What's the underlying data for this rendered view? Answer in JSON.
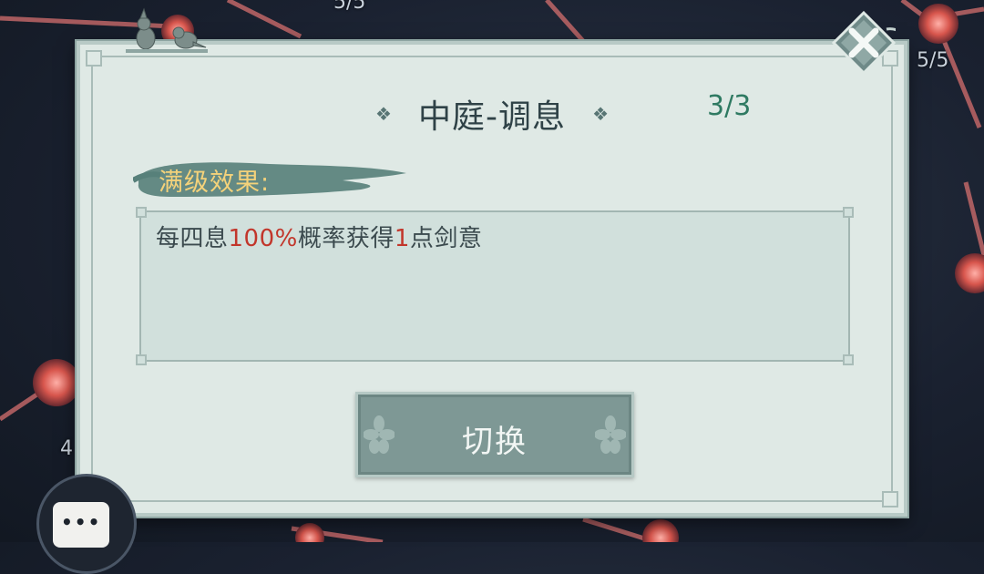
{
  "background": {
    "top_count": "5/5",
    "right_count": "5/5",
    "left_count": "4"
  },
  "dialog": {
    "title": "中庭-调息",
    "level": "3/3",
    "section_label": "满级效果:",
    "effect": {
      "prefix": "每四息",
      "percent": "100%",
      "middle": "概率获得",
      "amount": "1",
      "suffix": "点剑意"
    },
    "switch_button": "切换"
  },
  "colors": {
    "panel": "#dfe9e5",
    "highlight": "#c2362b",
    "level": "#2f7a62",
    "label_gold": "#f4d27a"
  },
  "icons": [
    "close-icon",
    "birds-ornament",
    "chat-bubble-icon",
    "diamond-ornament-icon",
    "flower-ornament-icon"
  ]
}
